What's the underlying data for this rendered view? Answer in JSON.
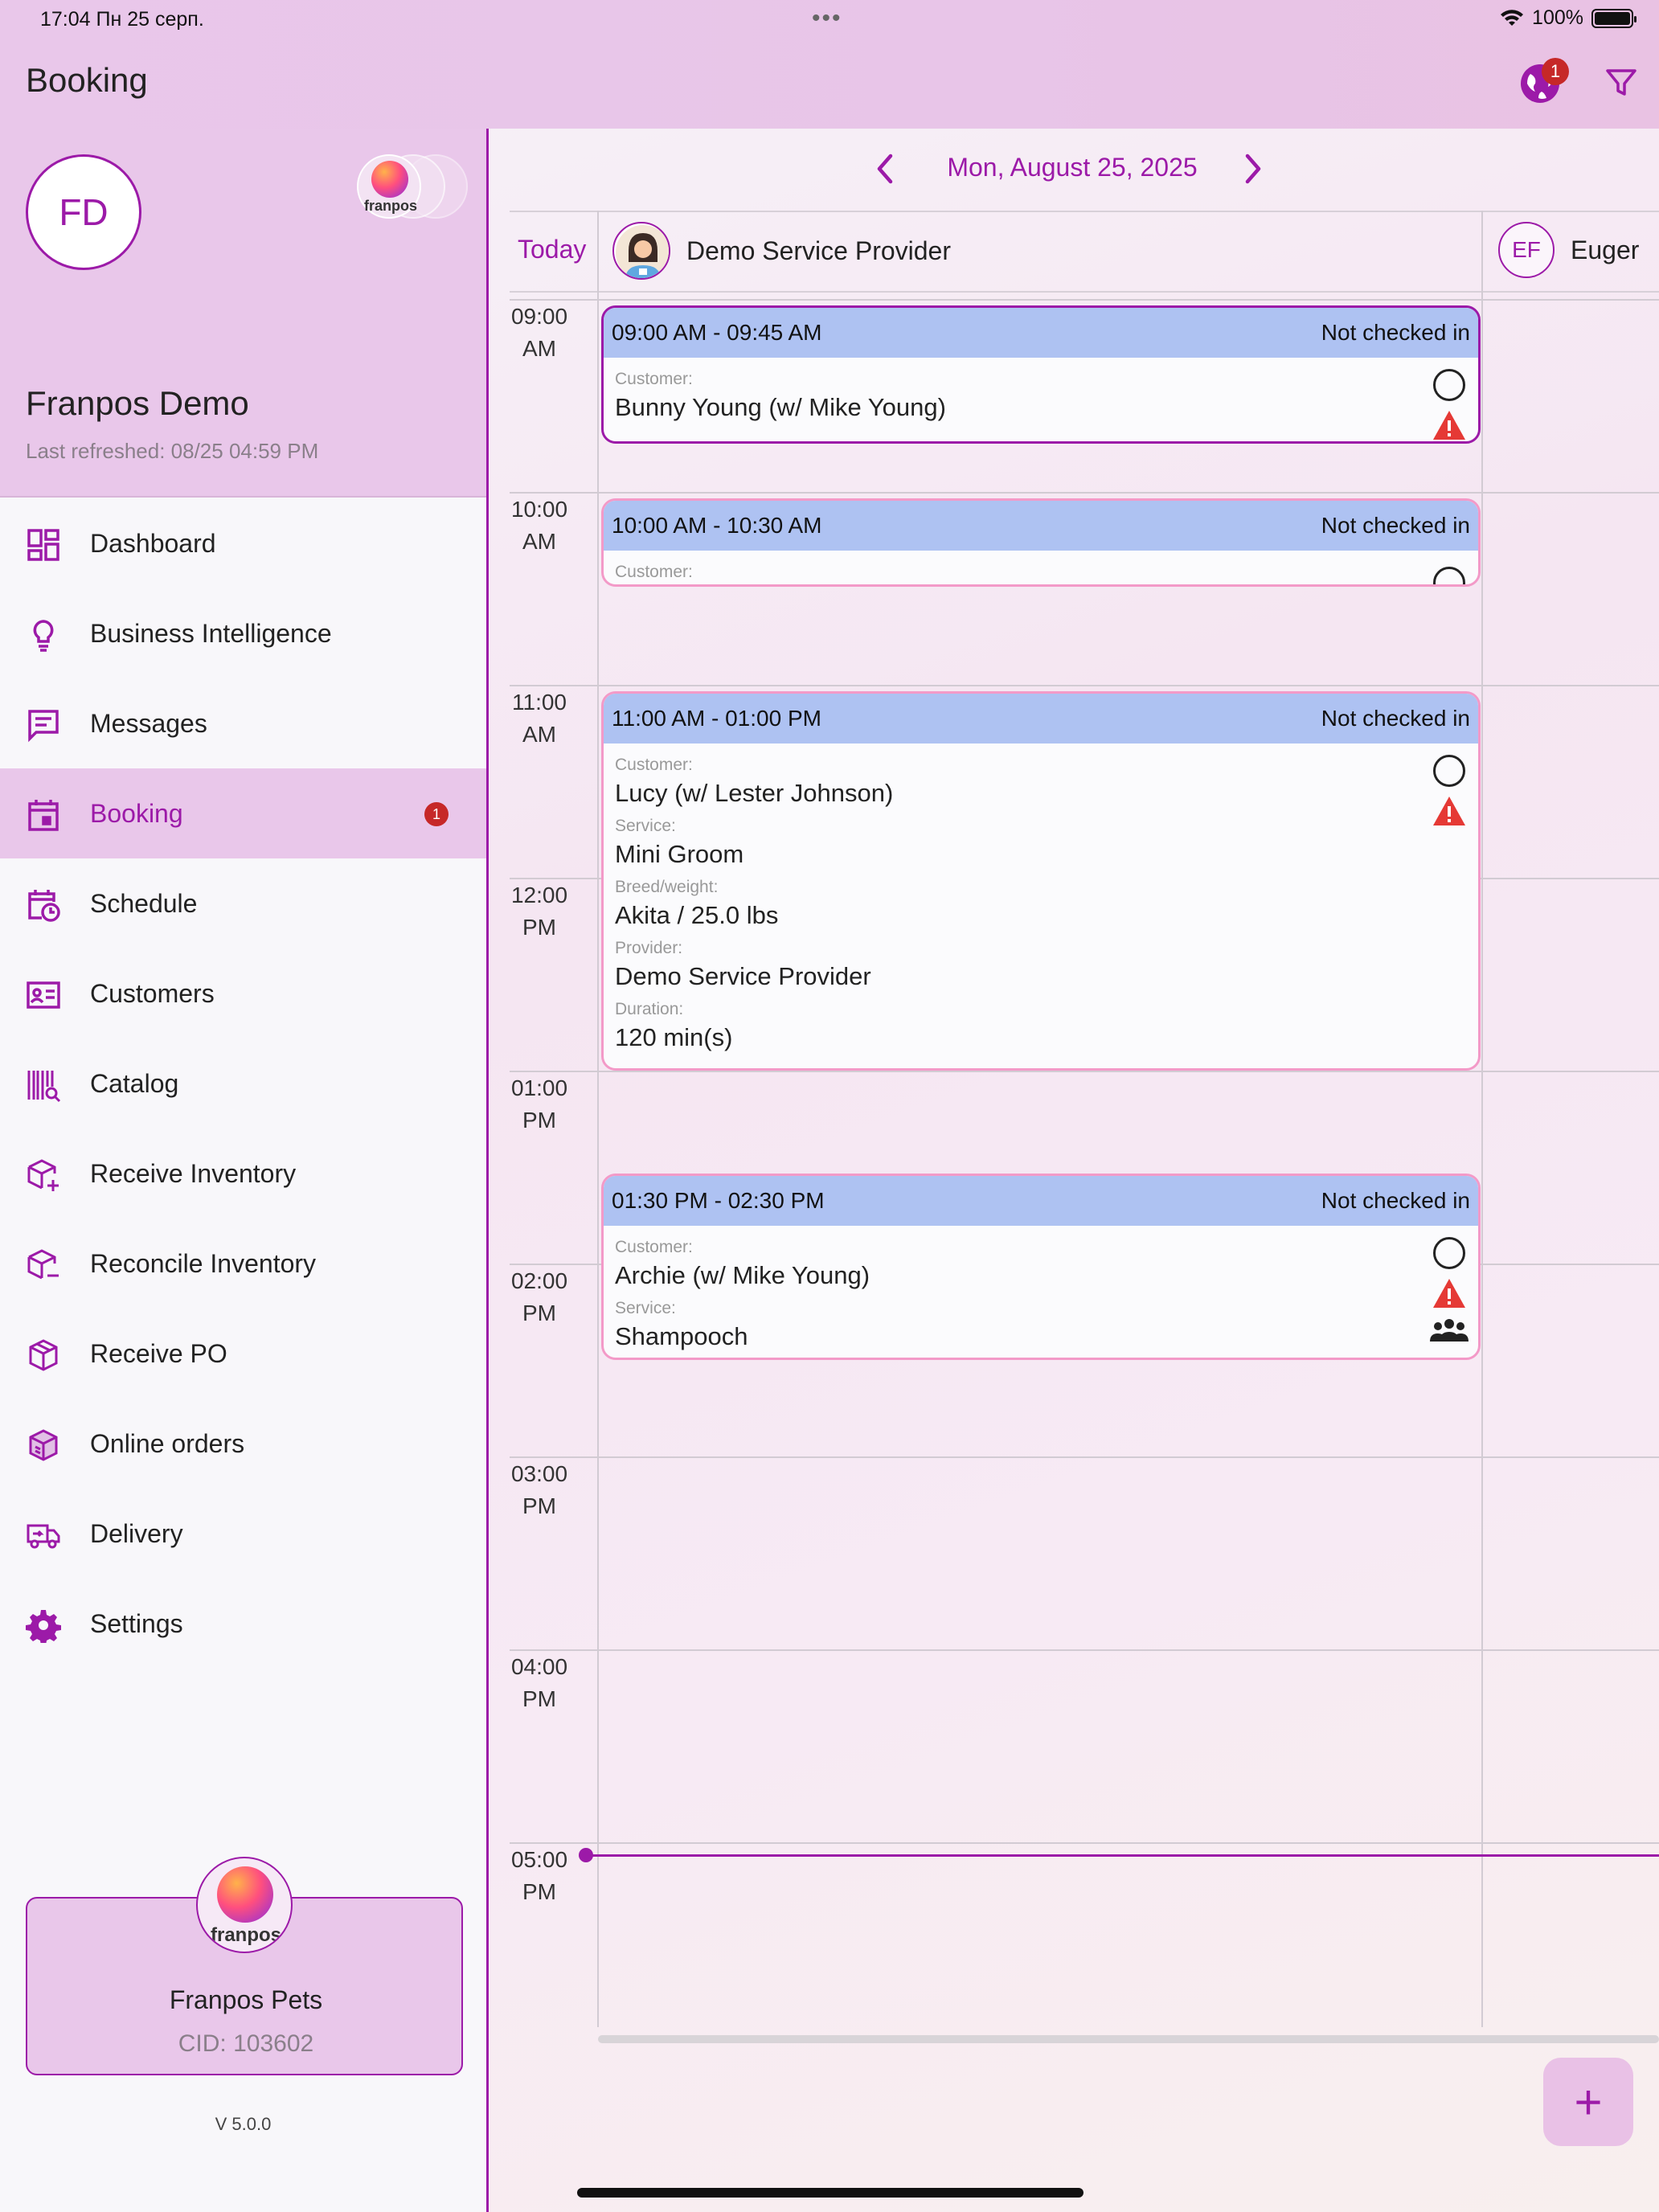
{
  "status_bar": {
    "time_date": "17:04  Пн 25 серп.",
    "battery": "100%"
  },
  "app_bar": {
    "title": "Booking",
    "notification_count": "1"
  },
  "profile": {
    "initials": "FD",
    "name": "Franpos Demo",
    "last_refreshed": "Last refreshed: 08/25 04:59 PM",
    "logo_text": "franpos"
  },
  "nav": {
    "items": [
      {
        "label": "Dashboard",
        "icon": "dashboard-icon"
      },
      {
        "label": "Business Intelligence",
        "icon": "lightbulb-icon"
      },
      {
        "label": "Messages",
        "icon": "message-icon"
      },
      {
        "label": "Booking",
        "icon": "calendar-icon",
        "active": true,
        "badge": "1"
      },
      {
        "label": "Schedule",
        "icon": "calendar-clock-icon"
      },
      {
        "label": "Customers",
        "icon": "contact-card-icon"
      },
      {
        "label": "Catalog",
        "icon": "barcode-search-icon"
      },
      {
        "label": "Receive Inventory",
        "icon": "box-plus-icon"
      },
      {
        "label": "Reconcile Inventory",
        "icon": "box-minus-icon"
      },
      {
        "label": "Receive PO",
        "icon": "box-icon"
      },
      {
        "label": "Online orders",
        "icon": "box-arrows-icon"
      },
      {
        "label": "Delivery",
        "icon": "truck-icon"
      },
      {
        "label": "Settings",
        "icon": "gear-icon"
      }
    ]
  },
  "store": {
    "logo_text": "franpos",
    "name": "Franpos Pets",
    "cid": "CID: 103602"
  },
  "version": "V 5.0.0",
  "calendar": {
    "date": "Mon, August 25, 2025",
    "today_label": "Today",
    "provider_name": "Demo Service Provider",
    "second_provider_initials": "EF",
    "second_provider_name": "Euger",
    "hours": [
      [
        "09:00",
        "AM"
      ],
      [
        "10:00",
        "AM"
      ],
      [
        "11:00",
        "AM"
      ],
      [
        "12:00",
        "PM"
      ],
      [
        "01:00",
        "PM"
      ],
      [
        "02:00",
        "PM"
      ],
      [
        "03:00",
        "PM"
      ],
      [
        "04:00",
        "PM"
      ],
      [
        "05:00",
        "PM"
      ]
    ],
    "appointments": [
      {
        "time": "09:00 AM - 09:45 AM",
        "status": "Not checked in",
        "fields": [
          {
            "label": "Customer:",
            "value": "Bunny Young (w/ Mike Young)"
          }
        ]
      },
      {
        "time": "10:00 AM - 10:30 AM",
        "status": "Not checked in",
        "fields": [
          {
            "label": "Customer:",
            "value": ""
          }
        ]
      },
      {
        "time": "11:00 AM - 01:00 PM",
        "status": "Not checked in",
        "fields": [
          {
            "label": "Customer:",
            "value": "Lucy (w/ Lester Johnson)"
          },
          {
            "label": "Service:",
            "value": "Mini Groom"
          },
          {
            "label": "Breed/weight:",
            "value": "Akita / 25.0 lbs"
          },
          {
            "label": "Provider:",
            "value": "Demo Service Provider"
          },
          {
            "label": "Duration:",
            "value": "120 min(s)"
          }
        ]
      },
      {
        "time": "01:30 PM - 02:30 PM",
        "status": "Not checked in",
        "fields": [
          {
            "label": "Customer:",
            "value": "Archie (w/ Mike Young)"
          },
          {
            "label": "Service:",
            "value": "Shampooch"
          }
        ]
      }
    ]
  },
  "fab_label": "+",
  "colors": {
    "accent": "#9c1aa8",
    "header_bg": "#e9c7ea",
    "appt_header": "#aec2f2",
    "appt_border": "#f39ac8",
    "warning": "#e53935",
    "badge": "#c62828"
  }
}
